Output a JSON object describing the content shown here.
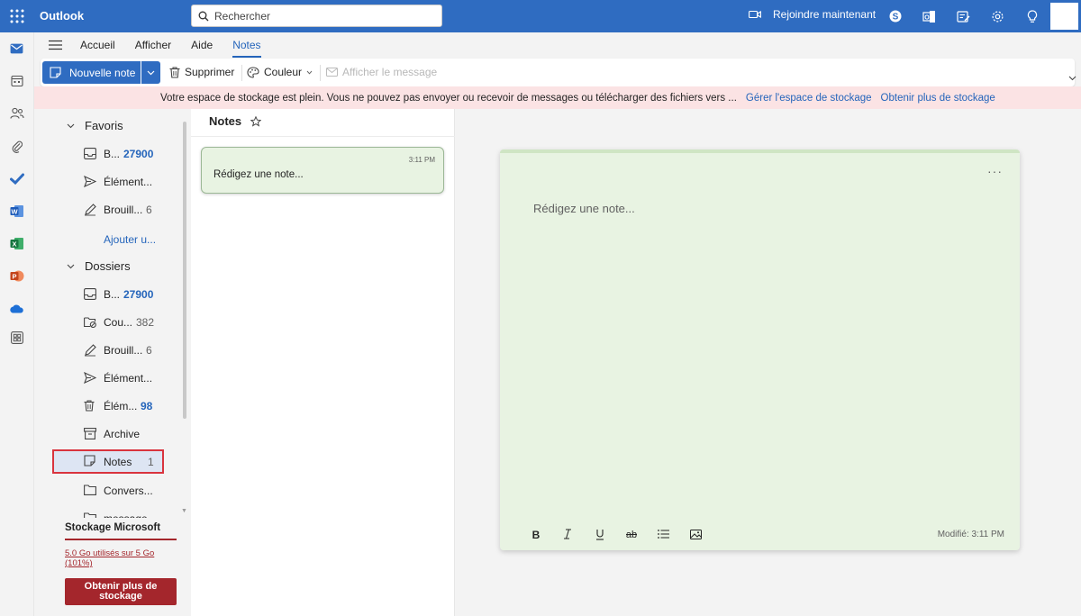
{
  "app": {
    "name": "Outlook"
  },
  "search": {
    "placeholder": "Rechercher"
  },
  "header": {
    "meet_label": "Rejoindre maintenant"
  },
  "menu": {
    "tabs": [
      {
        "label": "Accueil"
      },
      {
        "label": "Afficher"
      },
      {
        "label": "Aide"
      },
      {
        "label": "Notes"
      }
    ]
  },
  "ribbon": {
    "new_note": "Nouvelle note",
    "delete": "Supprimer",
    "color": "Couleur",
    "show_message": "Afficher le message"
  },
  "banner": {
    "message": "Votre espace de stockage est plein. Vous ne pouvez pas envoyer ou recevoir de messages ou télécharger des fichiers vers ...",
    "manage_link": "Gérer l'espace de stockage",
    "more_link": "Obtenir plus de stockage"
  },
  "folders": {
    "favorites_title": "Favoris",
    "favorites": [
      {
        "label": "B...",
        "count": "27900"
      },
      {
        "label": "Élément...",
        "count": ""
      },
      {
        "label": "Brouill...",
        "count": "6"
      }
    ],
    "add_favorite": "Ajouter u...",
    "folders_title": "Dossiers",
    "items": [
      {
        "label": "B...",
        "count": "27900"
      },
      {
        "label": "Cou...",
        "count": "382"
      },
      {
        "label": "Brouill...",
        "count": "6"
      },
      {
        "label": "Élément...",
        "count": ""
      },
      {
        "label": "Élém...",
        "count": "98"
      },
      {
        "label": "Archive",
        "count": ""
      },
      {
        "label": "Notes",
        "count": "1"
      },
      {
        "label": "Convers...",
        "count": ""
      },
      {
        "label": "message",
        "count": ""
      }
    ]
  },
  "storage": {
    "title": "Stockage Microsoft",
    "usage": "5.0 Go utilisés sur 5 Go (101%)",
    "button": "Obtenir plus de stockage"
  },
  "notes_list": {
    "title": "Notes",
    "items": [
      {
        "time": "3:11 PM",
        "text": "Rédigez une note..."
      }
    ]
  },
  "note_editor": {
    "more": "···",
    "placeholder": "Rédigez une note...",
    "modified": "Modifié: 3:11 PM"
  },
  "colors": {
    "brand": "#2f6cc1",
    "note_bg": "#e8f3e2",
    "alert_bg": "#fbe3e4",
    "alert_red": "#a4262c"
  }
}
